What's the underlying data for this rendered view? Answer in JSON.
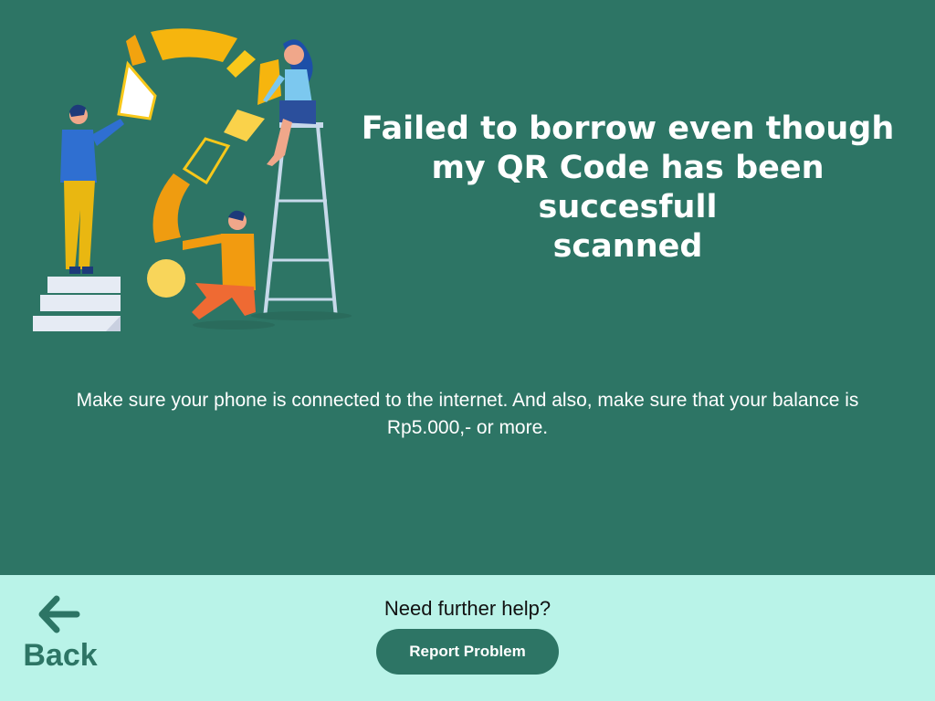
{
  "main": {
    "title": "Failed to borrow even though\n my QR Code has been succesfull\nscanned",
    "message": "Make sure your phone is connected to the internet. And also, make sure that your balance is Rp5.000,- or more.",
    "illustration_icon": "question-mark-team-illustration"
  },
  "footer": {
    "back_label": "Back",
    "back_icon": "arrow-left-icon",
    "help_text": "Need further help?",
    "report_label": "Report Problem"
  },
  "colors": {
    "background": "#2d7565",
    "footer_background": "#b9f3e8",
    "button": "#2d7565",
    "text_light": "#ffffff",
    "text_dark": "#111111"
  }
}
